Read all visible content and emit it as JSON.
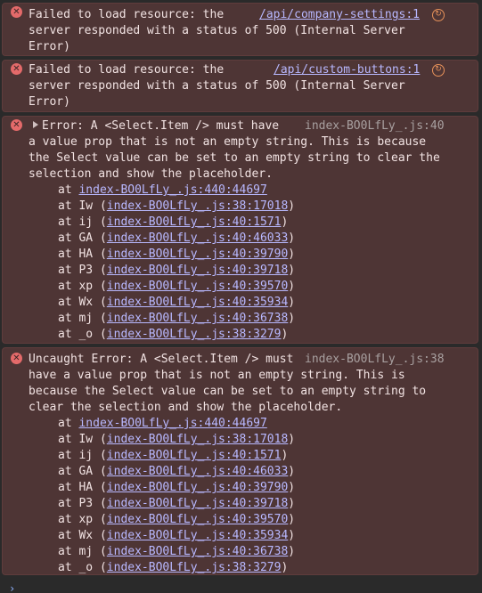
{
  "messages": [
    {
      "lines": [
        "Failed to load resource: the",
        "server responded with a status of 500 (Internal Server",
        "Error)"
      ],
      "source": "/api/company-settings:1"
    },
    {
      "lines": [
        "Failed to load resource: the",
        "server responded with a status of 500 (Internal Server",
        "Error)"
      ],
      "source": "/api/custom-buttons:1"
    },
    {
      "first": "Error: A <Select.Item /> must have",
      "lines": [
        "a value prop that is not an empty string. This is because",
        "the Select value can be set to an empty string to clear the",
        "selection and show the placeholder."
      ],
      "source": "index-BO0LfLy_.js:40",
      "stack": [
        {
          "fn": "at ",
          "loc": "index-BO0LfLy_.js:440:44697",
          "paren": false
        },
        {
          "fn": "at Iw ",
          "loc": "index-BO0LfLy_.js:38:17018",
          "paren": true
        },
        {
          "fn": "at ij ",
          "loc": "index-BO0LfLy_.js:40:1571",
          "paren": true
        },
        {
          "fn": "at GA ",
          "loc": "index-BO0LfLy_.js:40:46033",
          "paren": true
        },
        {
          "fn": "at HA ",
          "loc": "index-BO0LfLy_.js:40:39790",
          "paren": true
        },
        {
          "fn": "at P3 ",
          "loc": "index-BO0LfLy_.js:40:39718",
          "paren": true
        },
        {
          "fn": "at xp ",
          "loc": "index-BO0LfLy_.js:40:39570",
          "paren": true
        },
        {
          "fn": "at Wx ",
          "loc": "index-BO0LfLy_.js:40:35934",
          "paren": true
        },
        {
          "fn": "at mj ",
          "loc": "index-BO0LfLy_.js:40:36738",
          "paren": true
        },
        {
          "fn": "at _o ",
          "loc": "index-BO0LfLy_.js:38:3279",
          "paren": true
        }
      ]
    },
    {
      "first": "Uncaught Error: A <Select.Item /> must",
      "lines": [
        "have a value prop that is not an empty string. This is",
        "because the Select value can be set to an empty string to",
        "clear the selection and show the placeholder."
      ],
      "source": "index-BO0LfLy_.js:38",
      "stack": [
        {
          "fn": "at ",
          "loc": "index-BO0LfLy_.js:440:44697",
          "paren": false
        },
        {
          "fn": "at Iw ",
          "loc": "index-BO0LfLy_.js:38:17018",
          "paren": true
        },
        {
          "fn": "at ij ",
          "loc": "index-BO0LfLy_.js:40:1571",
          "paren": true
        },
        {
          "fn": "at GA ",
          "loc": "index-BO0LfLy_.js:40:46033",
          "paren": true
        },
        {
          "fn": "at HA ",
          "loc": "index-BO0LfLy_.js:40:39790",
          "paren": true
        },
        {
          "fn": "at P3 ",
          "loc": "index-BO0LfLy_.js:40:39718",
          "paren": true
        },
        {
          "fn": "at xp ",
          "loc": "index-BO0LfLy_.js:40:39570",
          "paren": true
        },
        {
          "fn": "at Wx ",
          "loc": "index-BO0LfLy_.js:40:35934",
          "paren": true
        },
        {
          "fn": "at mj ",
          "loc": "index-BO0LfLy_.js:40:36738",
          "paren": true
        },
        {
          "fn": "at _o ",
          "loc": "index-BO0LfLy_.js:38:3279",
          "paren": true
        }
      ]
    }
  ],
  "icons": {
    "error": "error-icon",
    "reload": "reload-icon",
    "expand": "expand-triangle-icon",
    "prompt": "prompt-chevron-icon"
  },
  "prompt_symbol": "›",
  "colors": {
    "error_bg": "#4e3535",
    "error_icon": "#e46a6a",
    "link": "#b8b8ff",
    "reload": "#e8925a"
  }
}
